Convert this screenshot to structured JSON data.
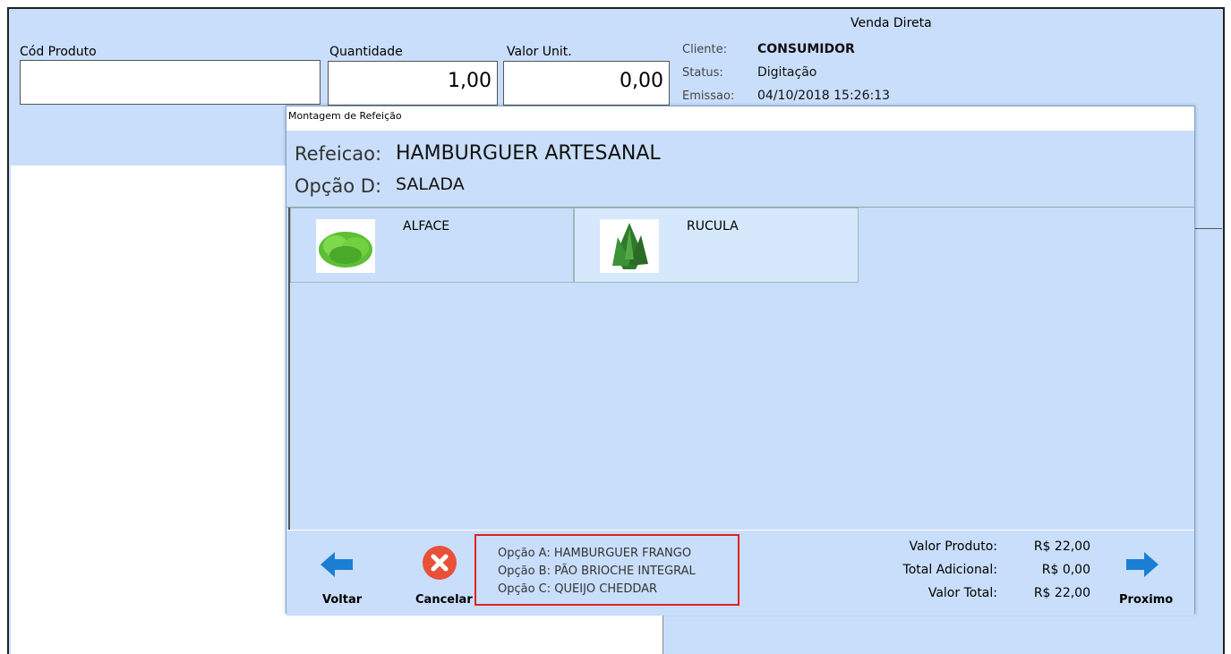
{
  "header": {
    "title": "Venda Direta",
    "cod_produto_label": "Cód Produto",
    "cod_produto_value": "",
    "quantidade_label": "Quantidade",
    "quantidade_value": "1,00",
    "valor_unit_label": "Valor Unit.",
    "valor_unit_value": "0,00",
    "cliente_label": "Cliente:",
    "cliente_value": "CONSUMIDOR",
    "status_label": "Status:",
    "status_value": "Digitação",
    "emissao_label": "Emissao:",
    "emissao_value": "04/10/2018 15:26:13"
  },
  "dialog": {
    "title": "Montagem de Refeição",
    "refeicao_label": "Refeicao:",
    "refeicao_value": "HAMBURGUER ARTESANAL",
    "opcao_label": "Opção D:",
    "opcao_value": "SALADA",
    "items": [
      {
        "label": "ALFACE",
        "icon": "lettuce-icon"
      },
      {
        "label": "RUCULA",
        "icon": "arugula-icon"
      }
    ],
    "summary": [
      "Opção A: HAMBURGUER FRANGO",
      "Opção B: PÃO BRIOCHE INTEGRAL",
      "Opção C: QUEIJO CHEDDAR"
    ],
    "totals": {
      "valor_produto_label": "Valor Produto:",
      "valor_produto_value": "R$ 22,00",
      "total_adicional_label": "Total Adicional:",
      "total_adicional_value": "R$ 0,00",
      "valor_total_label": "Valor Total:",
      "valor_total_value": "R$ 22,00"
    },
    "buttons": {
      "voltar": "Voltar",
      "cancelar": "Cancelar",
      "proximo": "Proximo"
    }
  },
  "colors": {
    "background": "#c9defa",
    "accent": "#1a7fd4",
    "cancel": "#e8503a",
    "highlight_border": "#e02020"
  }
}
